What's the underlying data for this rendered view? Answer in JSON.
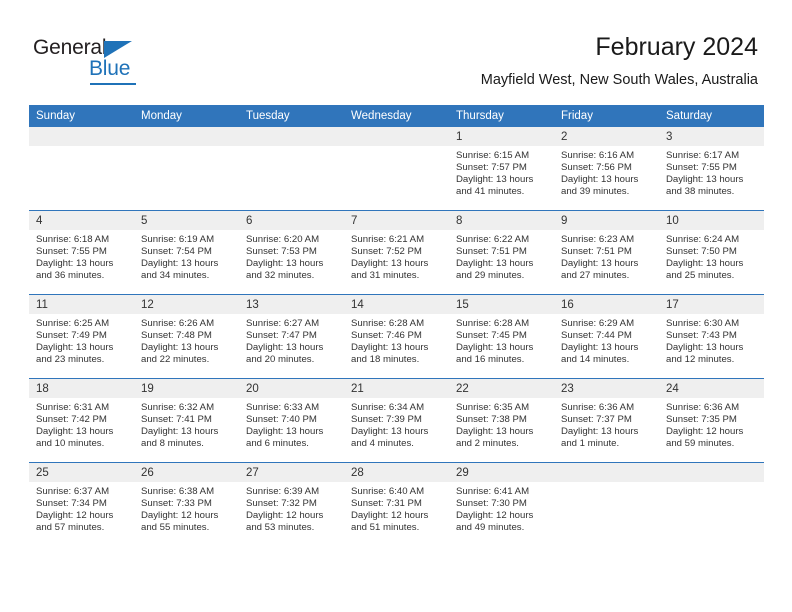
{
  "logo": {
    "word_top": "General",
    "word_bottom": "Blue",
    "accent_color": "#1f72b8"
  },
  "header": {
    "title": "February 2024",
    "subtitle": "Mayfield West, New South Wales, Australia"
  },
  "theme": {
    "header_blue": "#3075bb",
    "daynum_gray": "#efefef",
    "text": "#333333"
  },
  "weekdays": [
    "Sunday",
    "Monday",
    "Tuesday",
    "Wednesday",
    "Thursday",
    "Friday",
    "Saturday"
  ],
  "labels": {
    "sunrise": "Sunrise:",
    "sunset": "Sunset:",
    "daylight": "Daylight:"
  },
  "weeks": [
    [
      {
        "day": "",
        "blank": true,
        "sunrise": "",
        "sunset": "",
        "daylight": ""
      },
      {
        "day": "",
        "blank": true,
        "sunrise": "",
        "sunset": "",
        "daylight": ""
      },
      {
        "day": "",
        "blank": true,
        "sunrise": "",
        "sunset": "",
        "daylight": ""
      },
      {
        "day": "",
        "blank": true,
        "sunrise": "",
        "sunset": "",
        "daylight": ""
      },
      {
        "day": "1",
        "sunrise": "Sunrise: 6:15 AM",
        "sunset": "Sunset: 7:57 PM",
        "daylight": "Daylight: 13 hours and 41 minutes."
      },
      {
        "day": "2",
        "sunrise": "Sunrise: 6:16 AM",
        "sunset": "Sunset: 7:56 PM",
        "daylight": "Daylight: 13 hours and 39 minutes."
      },
      {
        "day": "3",
        "sunrise": "Sunrise: 6:17 AM",
        "sunset": "Sunset: 7:55 PM",
        "daylight": "Daylight: 13 hours and 38 minutes."
      }
    ],
    [
      {
        "day": "4",
        "sunrise": "Sunrise: 6:18 AM",
        "sunset": "Sunset: 7:55 PM",
        "daylight": "Daylight: 13 hours and 36 minutes."
      },
      {
        "day": "5",
        "sunrise": "Sunrise: 6:19 AM",
        "sunset": "Sunset: 7:54 PM",
        "daylight": "Daylight: 13 hours and 34 minutes."
      },
      {
        "day": "6",
        "sunrise": "Sunrise: 6:20 AM",
        "sunset": "Sunset: 7:53 PM",
        "daylight": "Daylight: 13 hours and 32 minutes."
      },
      {
        "day": "7",
        "sunrise": "Sunrise: 6:21 AM",
        "sunset": "Sunset: 7:52 PM",
        "daylight": "Daylight: 13 hours and 31 minutes."
      },
      {
        "day": "8",
        "sunrise": "Sunrise: 6:22 AM",
        "sunset": "Sunset: 7:51 PM",
        "daylight": "Daylight: 13 hours and 29 minutes."
      },
      {
        "day": "9",
        "sunrise": "Sunrise: 6:23 AM",
        "sunset": "Sunset: 7:51 PM",
        "daylight": "Daylight: 13 hours and 27 minutes."
      },
      {
        "day": "10",
        "sunrise": "Sunrise: 6:24 AM",
        "sunset": "Sunset: 7:50 PM",
        "daylight": "Daylight: 13 hours and 25 minutes."
      }
    ],
    [
      {
        "day": "11",
        "sunrise": "Sunrise: 6:25 AM",
        "sunset": "Sunset: 7:49 PM",
        "daylight": "Daylight: 13 hours and 23 minutes."
      },
      {
        "day": "12",
        "sunrise": "Sunrise: 6:26 AM",
        "sunset": "Sunset: 7:48 PM",
        "daylight": "Daylight: 13 hours and 22 minutes."
      },
      {
        "day": "13",
        "sunrise": "Sunrise: 6:27 AM",
        "sunset": "Sunset: 7:47 PM",
        "daylight": "Daylight: 13 hours and 20 minutes."
      },
      {
        "day": "14",
        "sunrise": "Sunrise: 6:28 AM",
        "sunset": "Sunset: 7:46 PM",
        "daylight": "Daylight: 13 hours and 18 minutes."
      },
      {
        "day": "15",
        "sunrise": "Sunrise: 6:28 AM",
        "sunset": "Sunset: 7:45 PM",
        "daylight": "Daylight: 13 hours and 16 minutes."
      },
      {
        "day": "16",
        "sunrise": "Sunrise: 6:29 AM",
        "sunset": "Sunset: 7:44 PM",
        "daylight": "Daylight: 13 hours and 14 minutes."
      },
      {
        "day": "17",
        "sunrise": "Sunrise: 6:30 AM",
        "sunset": "Sunset: 7:43 PM",
        "daylight": "Daylight: 13 hours and 12 minutes."
      }
    ],
    [
      {
        "day": "18",
        "sunrise": "Sunrise: 6:31 AM",
        "sunset": "Sunset: 7:42 PM",
        "daylight": "Daylight: 13 hours and 10 minutes."
      },
      {
        "day": "19",
        "sunrise": "Sunrise: 6:32 AM",
        "sunset": "Sunset: 7:41 PM",
        "daylight": "Daylight: 13 hours and 8 minutes."
      },
      {
        "day": "20",
        "sunrise": "Sunrise: 6:33 AM",
        "sunset": "Sunset: 7:40 PM",
        "daylight": "Daylight: 13 hours and 6 minutes."
      },
      {
        "day": "21",
        "sunrise": "Sunrise: 6:34 AM",
        "sunset": "Sunset: 7:39 PM",
        "daylight": "Daylight: 13 hours and 4 minutes."
      },
      {
        "day": "22",
        "sunrise": "Sunrise: 6:35 AM",
        "sunset": "Sunset: 7:38 PM",
        "daylight": "Daylight: 13 hours and 2 minutes."
      },
      {
        "day": "23",
        "sunrise": "Sunrise: 6:36 AM",
        "sunset": "Sunset: 7:37 PM",
        "daylight": "Daylight: 13 hours and 1 minute."
      },
      {
        "day": "24",
        "sunrise": "Sunrise: 6:36 AM",
        "sunset": "Sunset: 7:35 PM",
        "daylight": "Daylight: 12 hours and 59 minutes."
      }
    ],
    [
      {
        "day": "25",
        "sunrise": "Sunrise: 6:37 AM",
        "sunset": "Sunset: 7:34 PM",
        "daylight": "Daylight: 12 hours and 57 minutes."
      },
      {
        "day": "26",
        "sunrise": "Sunrise: 6:38 AM",
        "sunset": "Sunset: 7:33 PM",
        "daylight": "Daylight: 12 hours and 55 minutes."
      },
      {
        "day": "27",
        "sunrise": "Sunrise: 6:39 AM",
        "sunset": "Sunset: 7:32 PM",
        "daylight": "Daylight: 12 hours and 53 minutes."
      },
      {
        "day": "28",
        "sunrise": "Sunrise: 6:40 AM",
        "sunset": "Sunset: 7:31 PM",
        "daylight": "Daylight: 12 hours and 51 minutes."
      },
      {
        "day": "29",
        "sunrise": "Sunrise: 6:41 AM",
        "sunset": "Sunset: 7:30 PM",
        "daylight": "Daylight: 12 hours and 49 minutes."
      },
      {
        "day": "",
        "blank": true,
        "sunrise": "",
        "sunset": "",
        "daylight": ""
      },
      {
        "day": "",
        "blank": true,
        "sunrise": "",
        "sunset": "",
        "daylight": ""
      }
    ]
  ]
}
